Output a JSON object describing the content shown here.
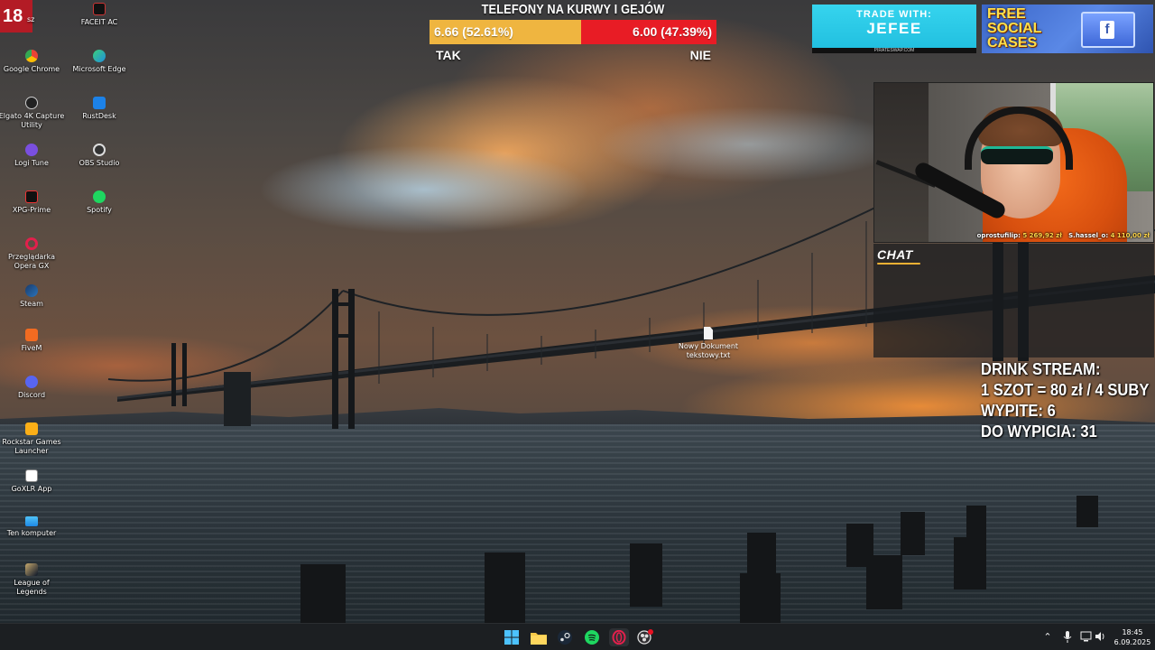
{
  "badge": {
    "text": "18",
    "label": "sz"
  },
  "desktop_icons": [
    {
      "label": "FACEIT AC",
      "icon": "faceit-icon"
    },
    {
      "label": "Google Chrome",
      "icon": "chrome-icon"
    },
    {
      "label": "Microsoft Edge",
      "icon": "edge-icon"
    },
    {
      "label": "Elgato 4K Capture Utility",
      "icon": "elgato-icon"
    },
    {
      "label": "RustDesk",
      "icon": "rustdesk-icon"
    },
    {
      "label": "Logi Tune",
      "icon": "logi-tune-icon"
    },
    {
      "label": "OBS Studio",
      "icon": "obs-icon"
    },
    {
      "label": "XPG-Prime",
      "icon": "xpg-icon"
    },
    {
      "label": "Spotify",
      "icon": "spotify-icon"
    },
    {
      "label": "Przeglądarka Opera GX",
      "icon": "opera-gx-icon"
    },
    {
      "label": "Steam",
      "icon": "steam-icon"
    },
    {
      "label": "FiveM",
      "icon": "fivem-icon"
    },
    {
      "label": "Discord",
      "icon": "discord-icon"
    },
    {
      "label": "Rockstar Games Launcher",
      "icon": "rockstar-icon"
    },
    {
      "label": "GoXLR App",
      "icon": "goxlr-icon"
    },
    {
      "label": "Ten komputer",
      "icon": "this-pc-icon"
    },
    {
      "label": "League of Legends",
      "icon": "league-icon"
    }
  ],
  "file_icon": {
    "label": "Nowy Dokument tekstowy.txt",
    "icon": "text-file-icon"
  },
  "poll": {
    "title": "TELEFONY NA KURWY I GEJÓW",
    "yes_value": "6.66 (52.61%)",
    "no_value": "6.00 (47.39%)",
    "yes_fraction": 0.5261,
    "no_fraction": 0.4739,
    "yes_label": "TAK",
    "no_label": "NIE",
    "yes_color": "#efb540",
    "no_color": "#e81c25"
  },
  "banners": {
    "trade": {
      "line1": "TRADE WITH:",
      "line2": "JEFEE",
      "line3": "PIRATESWAP.COM"
    },
    "cases": {
      "text": "FREE SOCIAL CASES",
      "icon": "facebook-icon"
    }
  },
  "webcam": {
    "donor1_name": "oprostufilip:",
    "donor1_amount": "5 269,92 zł",
    "donor2_name": "S.hassel_o:",
    "donor2_amount": "4 110,00 zł"
  },
  "chat": {
    "title": "CHAT"
  },
  "drink_stream": {
    "line1": "DRINK STREAM:",
    "line2": "1 SZOT = 80 zł / 4 SUBY",
    "line3": "WYPITE: 6",
    "line4": "DO WYPICIA: 31"
  },
  "taskbar": {
    "apps": [
      {
        "name": "start",
        "icon": "windows-start-icon"
      },
      {
        "name": "file-explorer",
        "icon": "folder-icon"
      },
      {
        "name": "steam",
        "icon": "steam-icon"
      },
      {
        "name": "spotify",
        "icon": "spotify-icon"
      },
      {
        "name": "opera-gx",
        "icon": "opera-gx-icon"
      },
      {
        "name": "obs",
        "icon": "obs-icon"
      }
    ],
    "tray": [
      "chevron-up-icon",
      "microphone-icon",
      "network-icon",
      "volume-icon"
    ],
    "time": "18:45",
    "date": "6.09.2025"
  },
  "colors": {
    "taskbar": "#1c1f22",
    "badge": "#b31b25",
    "chat_accent": "#f2b134",
    "trade_banner": "#22c0e0"
  }
}
